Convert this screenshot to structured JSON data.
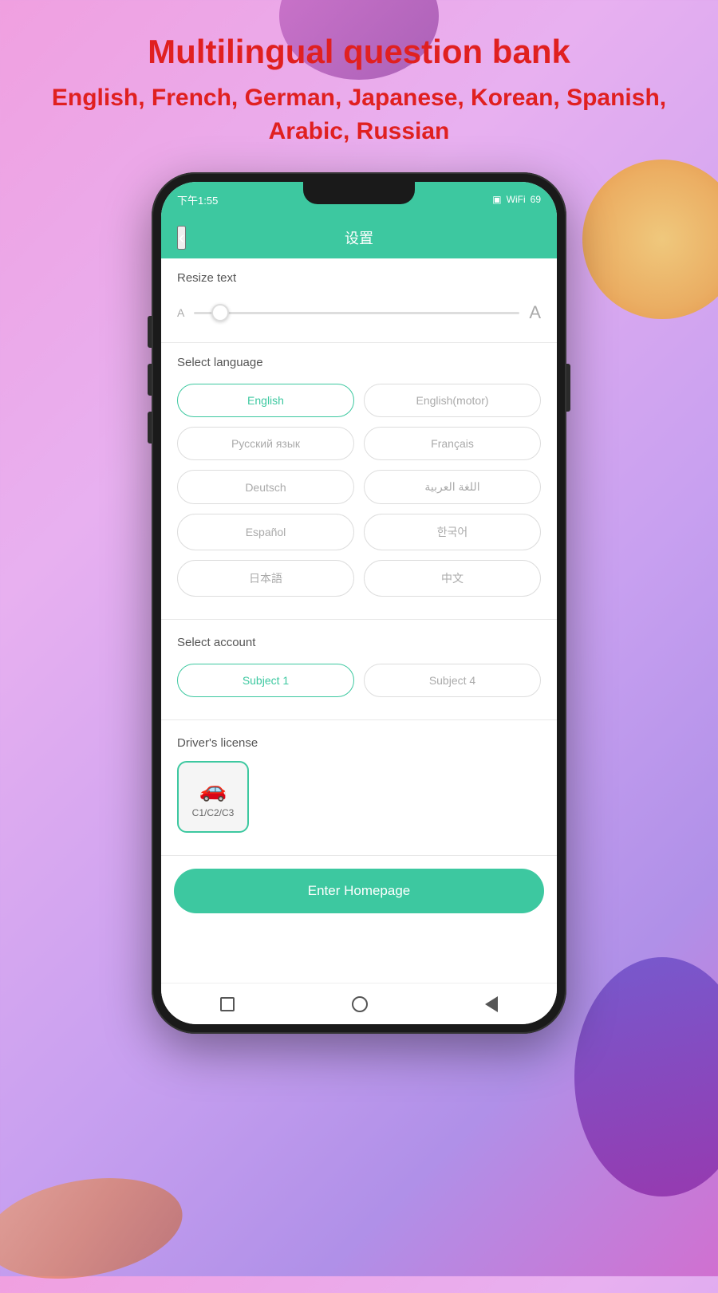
{
  "page": {
    "title": "Multilingual question bank",
    "subtitle": "English, French, German, Japanese, Korean, Spanish, Arabic, Russian"
  },
  "status_bar": {
    "time": "下午1:55",
    "title": "设置"
  },
  "header": {
    "back_label": "‹",
    "title": "设置"
  },
  "resize_text": {
    "label": "Resize text",
    "a_small": "A",
    "a_large": "A"
  },
  "select_language": {
    "label": "Select language",
    "languages": [
      {
        "key": "english",
        "label": "English",
        "selected": true
      },
      {
        "key": "english_motor",
        "label": "English(motor)",
        "selected": false
      },
      {
        "key": "russian",
        "label": "Русский язык",
        "selected": false
      },
      {
        "key": "french",
        "label": "Français",
        "selected": false
      },
      {
        "key": "german",
        "label": "Deutsch",
        "selected": false
      },
      {
        "key": "arabic",
        "label": "اللغة العربية",
        "selected": false
      },
      {
        "key": "spanish",
        "label": "Español",
        "selected": false
      },
      {
        "key": "korean",
        "label": "한국어",
        "selected": false
      },
      {
        "key": "japanese",
        "label": "日本語",
        "selected": false
      },
      {
        "key": "chinese",
        "label": "中文",
        "selected": false
      }
    ]
  },
  "select_account": {
    "label": "Select account",
    "accounts": [
      {
        "key": "subject1",
        "label": "Subject 1",
        "selected": true
      },
      {
        "key": "subject4",
        "label": "Subject 4",
        "selected": false
      }
    ]
  },
  "drivers_license": {
    "label": "Driver's license",
    "card_label": "C1/C2/C3",
    "car_icon": "🚗"
  },
  "enter_button": {
    "label": "Enter Homepage"
  },
  "colors": {
    "accent": "#3dc8a0",
    "primary_text": "#e02020"
  }
}
